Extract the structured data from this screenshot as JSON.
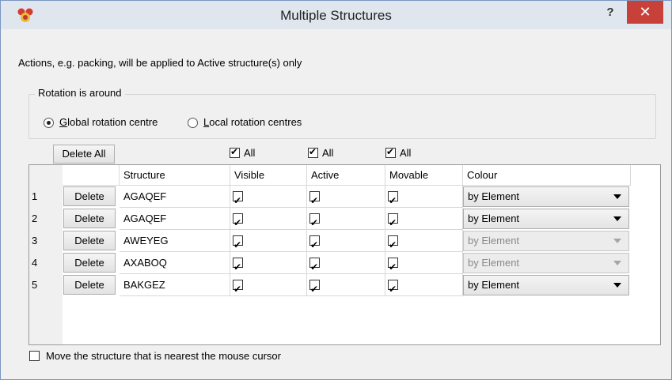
{
  "window": {
    "title": "Multiple Structures",
    "help_glyph": "?",
    "close_glyph": "✕"
  },
  "info_text": "Actions, e.g. packing, will be applied to Active structure(s) only",
  "rotation": {
    "group_title": "Rotation is around",
    "options": [
      {
        "label_u": "G",
        "label_rest": "lobal rotation centre",
        "checked": true
      },
      {
        "label_u": "L",
        "label_rest": "ocal rotation centres",
        "checked": false
      }
    ]
  },
  "toolbar": {
    "delete_all_label": "Delete All",
    "all_visible": {
      "label": "All",
      "checked": true
    },
    "all_active": {
      "label": "All",
      "checked": true
    },
    "all_movable": {
      "label": "All",
      "checked": true
    }
  },
  "table": {
    "headers": [
      "Structure",
      "Visible",
      "Active",
      "Movable",
      "Colour"
    ],
    "delete_label": "Delete",
    "rows": [
      {
        "num": "1",
        "structure": "AGAQEF",
        "visible": true,
        "active": true,
        "movable": true,
        "colour": "by Element",
        "colour_enabled": true
      },
      {
        "num": "2",
        "structure": "AGAQEF",
        "visible": true,
        "active": true,
        "movable": true,
        "colour": "by Element",
        "colour_enabled": true
      },
      {
        "num": "3",
        "structure": "AWEYEG",
        "visible": true,
        "active": true,
        "movable": true,
        "colour": "by Element",
        "colour_enabled": false
      },
      {
        "num": "4",
        "structure": "AXABOQ",
        "visible": true,
        "active": true,
        "movable": true,
        "colour": "by Element",
        "colour_enabled": false
      },
      {
        "num": "5",
        "structure": "BAKGEZ",
        "visible": true,
        "active": true,
        "movable": true,
        "colour": "by Element",
        "colour_enabled": true
      }
    ]
  },
  "move_nearest": {
    "label": "Move the structure that is nearest the mouse cursor",
    "checked": false
  },
  "colors": {
    "close_red": "#c7413a",
    "titlebar": "#dfe6ee"
  }
}
